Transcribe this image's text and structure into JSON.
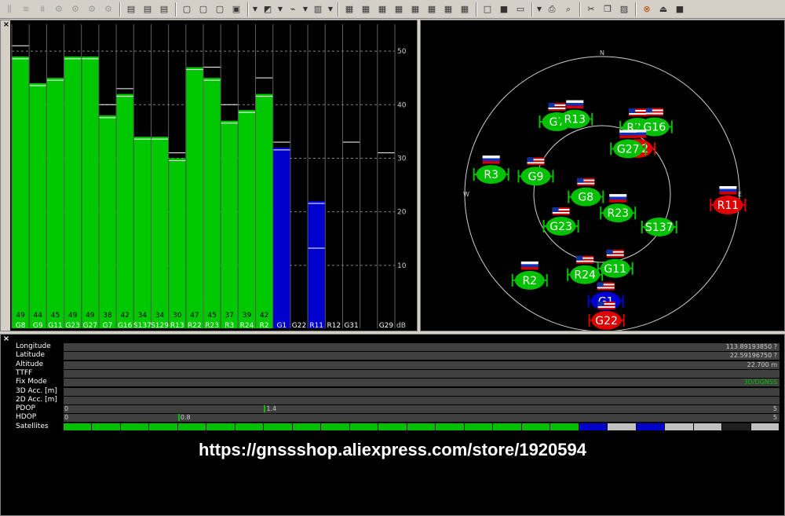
{
  "toolbar": {
    "icons": [
      "bar-icon",
      "wave-icon",
      "signal-icon",
      "gear-icon",
      "gear-icon",
      "gear-icon",
      "gear-icon",
      "doc-icon",
      "doc-icon",
      "doc-icon",
      "window-icon",
      "window-icon",
      "window-icon",
      "monitor-icon",
      "dropdown",
      "chart-icon",
      "dropdown",
      "graph-icon",
      "dropdown",
      "bars-icon",
      "dropdown",
      "display-icon",
      "display-icon",
      "display-icon",
      "display-icon",
      "display-icon",
      "display-icon",
      "display-icon",
      "display-icon",
      "new-icon",
      "save-icon",
      "open-icon",
      "dropdown",
      "print-icon",
      "preview-icon",
      "cut-icon",
      "copy-icon",
      "paste-icon",
      "stop-icon",
      "eject-icon",
      "square-icon"
    ]
  },
  "signal": {
    "axis_ticks": [
      "10",
      "20",
      "30",
      "40",
      "50"
    ],
    "unit": "dB",
    "ymax": 55,
    "satellites": [
      {
        "name": "G8",
        "value": 49,
        "peak": 51,
        "color": "green"
      },
      {
        "name": "G9",
        "value": 44,
        "peak": 44,
        "color": "green"
      },
      {
        "name": "G11",
        "value": 45,
        "peak": 45,
        "color": "green"
      },
      {
        "name": "G23",
        "value": 49,
        "peak": 49,
        "color": "green"
      },
      {
        "name": "G27",
        "value": 49,
        "peak": 49,
        "color": "green"
      },
      {
        "name": "G7",
        "value": 38,
        "peak": 40,
        "color": "green"
      },
      {
        "name": "G16",
        "value": 42,
        "peak": 43,
        "color": "green"
      },
      {
        "name": "S137",
        "value": 34,
        "peak": 34,
        "color": "green"
      },
      {
        "name": "S129",
        "value": 34,
        "peak": 34,
        "color": "green"
      },
      {
        "name": "R13",
        "value": 30,
        "peak": 31,
        "color": "green"
      },
      {
        "name": "R22",
        "value": 47,
        "peak": 47,
        "color": "green"
      },
      {
        "name": "R23",
        "value": 45,
        "peak": 47,
        "color": "green"
      },
      {
        "name": "R3",
        "value": 37,
        "peak": 40,
        "color": "green"
      },
      {
        "name": "R24",
        "value": 39,
        "peak": 39,
        "color": "green"
      },
      {
        "name": "R2",
        "value": 42,
        "peak": 45,
        "color": "green"
      },
      {
        "name": "G1",
        "value": 32,
        "peak": 33,
        "color": "blue"
      },
      {
        "name": "G22",
        "value": 0,
        "peak": 0,
        "color": "none"
      },
      {
        "name": "R11",
        "value": 22,
        "peak": 22,
        "color": "blue"
      },
      {
        "name": "R12",
        "value": 0,
        "peak": 0,
        "color": "none"
      },
      {
        "name": "G31",
        "value": 0,
        "peak": 33,
        "color": "none"
      },
      {
        "name": "",
        "value": 0,
        "peak": 0,
        "color": "none"
      },
      {
        "name": "G29",
        "value": 0,
        "peak": 31,
        "color": "none"
      }
    ],
    "value_labels": [
      "49",
      "44",
      "45",
      "49",
      "49",
      "38",
      "42",
      "34",
      "34",
      "30",
      "47",
      "45",
      "37",
      "39",
      "42",
      "",
      "",
      "",
      "",
      "",
      "",
      ""
    ]
  },
  "sky": {
    "compass": {
      "n": "N",
      "e": "E",
      "w": "W"
    },
    "sats": [
      {
        "name": "G7",
        "color": "green",
        "flag": "us",
        "az_deg": -32,
        "el": 0.62
      },
      {
        "name": "R13",
        "color": "green",
        "flag": "ru",
        "az_deg": -20,
        "el": 0.58
      },
      {
        "name": "R22",
        "color": "green",
        "flag": "us",
        "az_deg": 28,
        "el": 0.55
      },
      {
        "name": "G16",
        "color": "green",
        "flag": "us",
        "az_deg": 38,
        "el": 0.62
      },
      {
        "name": "R12",
        "color": "red",
        "flag": "ru",
        "az_deg": 38,
        "el": 0.42
      },
      {
        "name": "G27",
        "color": "green",
        "flag": "ru",
        "az_deg": 30,
        "el": 0.38
      },
      {
        "name": "R3",
        "color": "green",
        "flag": "ru",
        "az_deg": -80,
        "el": 0.82
      },
      {
        "name": "G9",
        "color": "green",
        "flag": "us",
        "az_deg": -75,
        "el": 0.5
      },
      {
        "name": "G8",
        "color": "green",
        "flag": "us",
        "az_deg": -100,
        "el": 0.12
      },
      {
        "name": "R23",
        "color": "green",
        "flag": "ru",
        "az_deg": 140,
        "el": 0.18
      },
      {
        "name": "G23",
        "color": "green",
        "flag": "us",
        "az_deg": -128,
        "el": 0.38
      },
      {
        "name": "S137",
        "color": "green",
        "flag": "none",
        "az_deg": 120,
        "el": 0.48
      },
      {
        "name": "R11",
        "color": "red",
        "flag": "ru",
        "az_deg": 95,
        "el": 0.92
      },
      {
        "name": "R2",
        "color": "green",
        "flag": "ru",
        "az_deg": -140,
        "el": 0.82
      },
      {
        "name": "G11",
        "color": "green",
        "flag": "us",
        "az_deg": 170,
        "el": 0.55
      },
      {
        "name": "R24",
        "color": "green",
        "flag": "us",
        "az_deg": -168,
        "el": 0.6
      },
      {
        "name": "G1",
        "color": "blue",
        "flag": "us",
        "az_deg": 178,
        "el": 0.78
      },
      {
        "name": "G22",
        "color": "red",
        "flag": "us",
        "az_deg": 178,
        "el": 0.92
      }
    ]
  },
  "status": {
    "rows": [
      {
        "label": "Longitude",
        "value": "113.89193850 ?"
      },
      {
        "label": "Latitude",
        "value": "22.59196750 ?"
      },
      {
        "label": "Altitude",
        "value": "22.700 m"
      },
      {
        "label": "TTFF",
        "value": ""
      },
      {
        "label": "Fix Mode",
        "value": "3D/DGNSS"
      },
      {
        "label": "3D Acc. [m]",
        "value": ""
      },
      {
        "label": "2D Acc. [m]",
        "value": ""
      }
    ],
    "pdop": {
      "label": "PDOP",
      "min": "0",
      "max": "5",
      "value": "1.4",
      "fraction": 0.28
    },
    "hdop": {
      "label": "HDOP",
      "min": "0",
      "max": "5",
      "value": "0.8",
      "fraction": 0.16
    },
    "satellites_label": "Satellites",
    "sat_bar": [
      "green",
      "green",
      "green",
      "green",
      "gap",
      "green",
      "green",
      "green",
      "green",
      "gap",
      "green",
      "green",
      "green",
      "green",
      "gap",
      "green",
      "green",
      "green",
      "blue",
      "gray",
      "blue",
      "gray",
      "gray",
      "black",
      "gray"
    ],
    "colors": {
      "green": "#00c000",
      "blue": "#0000cc",
      "gray": "#c0c0c0",
      "black": "#202020"
    }
  },
  "watermark": "https://gnssshop.aliexpress.com/store/1920594"
}
